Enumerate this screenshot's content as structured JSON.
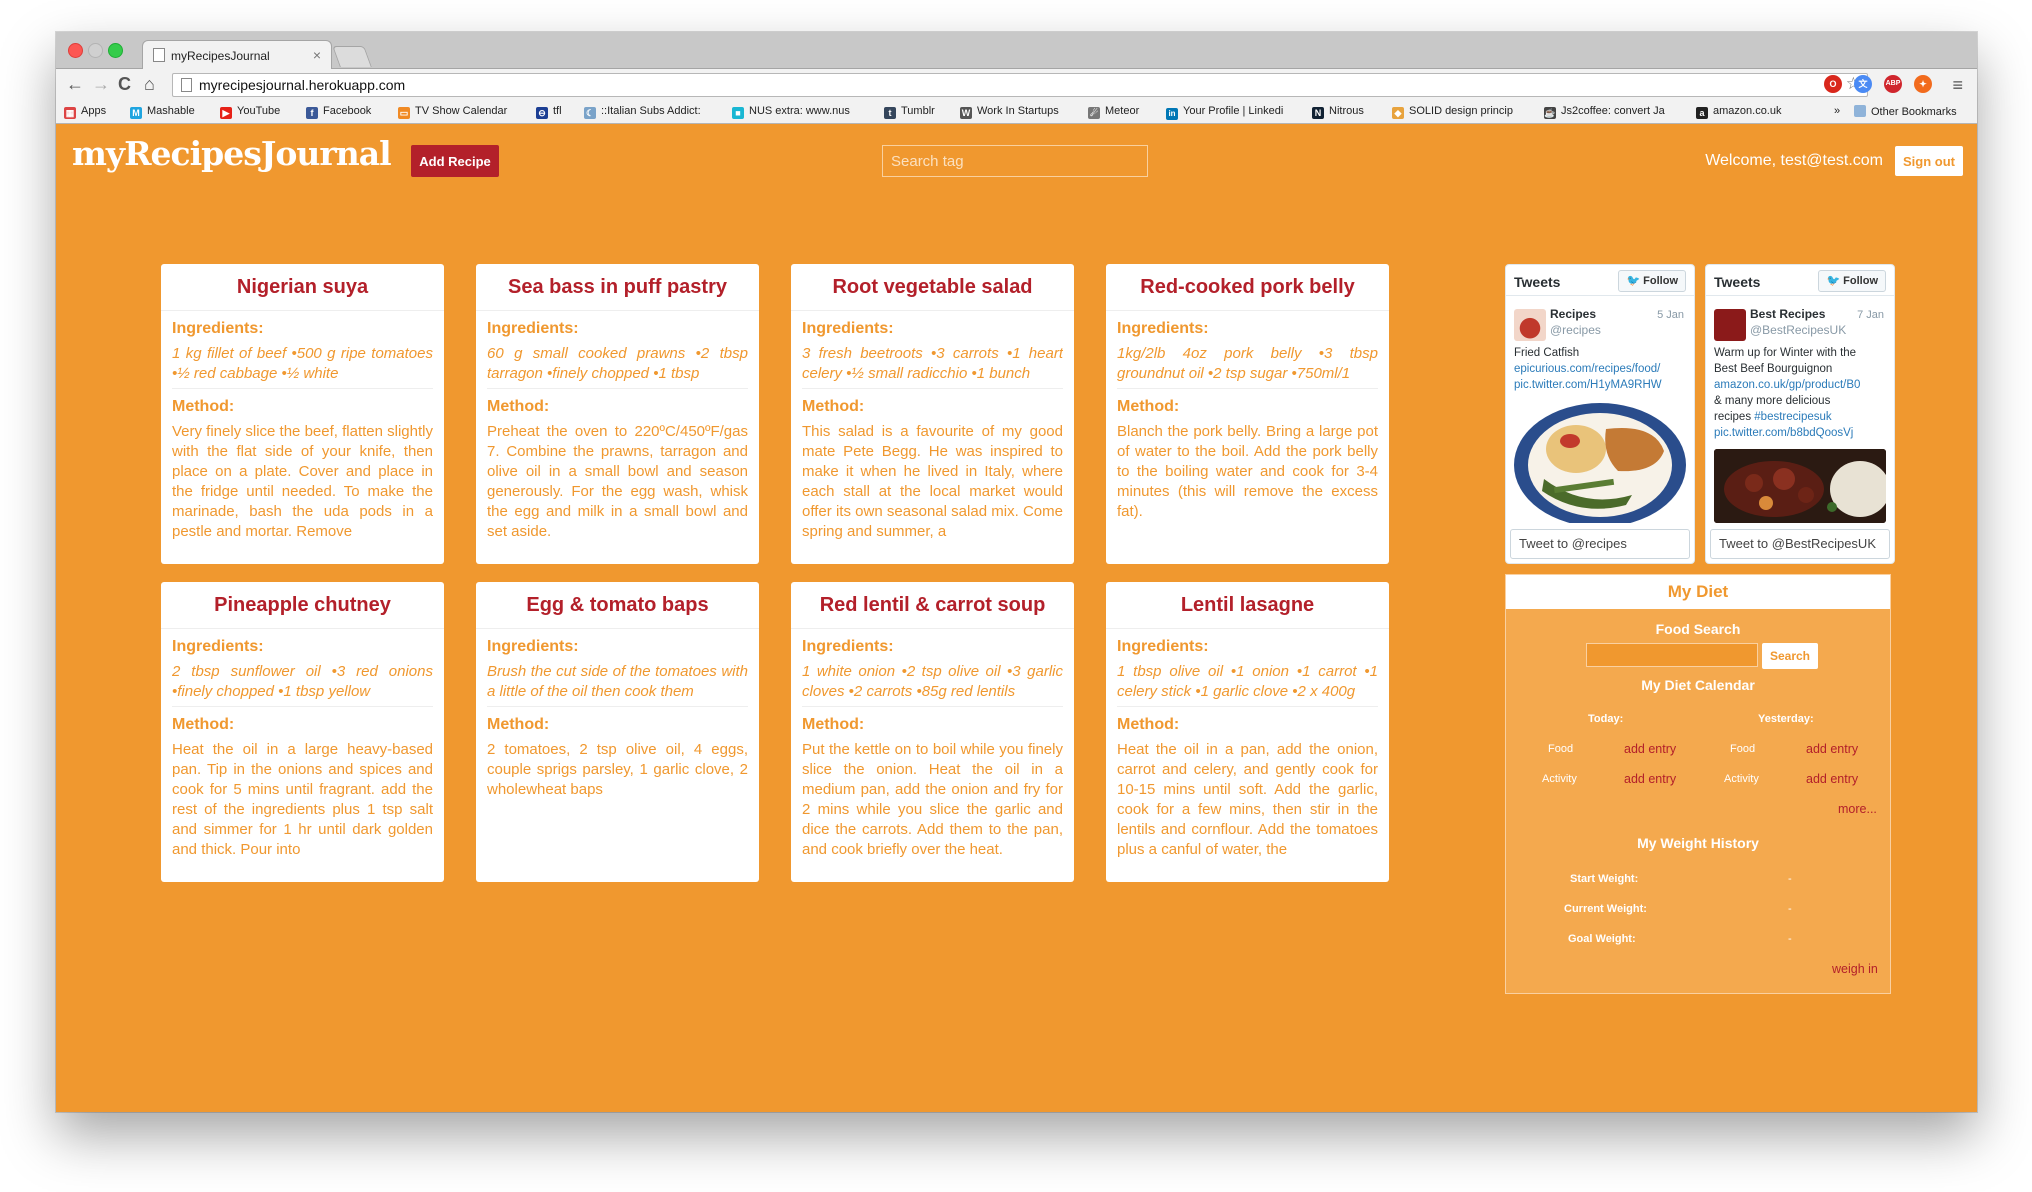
{
  "browser": {
    "tab_title": "myRecipesJournal",
    "tab_close": "×",
    "url": "myrecipesjournal.herokuapp.com",
    "back": "←",
    "forward": "→",
    "reload": "C",
    "home": "⌂",
    "star": "☆",
    "menu": "≡",
    "extensions": [
      {
        "name": "opera-ext-icon",
        "label": "O",
        "color": "#d9271c"
      },
      {
        "name": "translate-ext-icon",
        "label": "文",
        "color": "#4a8af4"
      },
      {
        "name": "adblock-ext-icon",
        "label": "ABP",
        "color": "#d0262d"
      },
      {
        "name": "flame-ext-icon",
        "label": "✦",
        "color": "#f26b1d"
      }
    ],
    "bookmarks": [
      {
        "name": "apps",
        "label": "Apps",
        "icon": "▦",
        "color": "#d44"
      },
      {
        "name": "mashable",
        "label": "Mashable",
        "icon": "M",
        "color": "#1fa5e0"
      },
      {
        "name": "youtube",
        "label": "YouTube",
        "icon": "▶",
        "color": "#e62117"
      },
      {
        "name": "facebook",
        "label": "Facebook",
        "icon": "f",
        "color": "#3b5998"
      },
      {
        "name": "tv-show-calendar",
        "label": "TV Show Calendar",
        "icon": "▭",
        "color": "#f08a24"
      },
      {
        "name": "tfl",
        "label": "tfl",
        "icon": "⊖",
        "color": "#1c3f94"
      },
      {
        "name": "italian-subs",
        "label": "::Italian Subs Addict:",
        "icon": "☾",
        "color": "#7aa3c9"
      },
      {
        "name": "nus-extra",
        "label": "NUS extra: www.nus",
        "icon": "■",
        "color": "#19b7d3"
      },
      {
        "name": "tumblr",
        "label": "Tumblr",
        "icon": "t",
        "color": "#35465c"
      },
      {
        "name": "work-in-startups",
        "label": "Work In Startups",
        "icon": "W",
        "color": "#555"
      },
      {
        "name": "meteor",
        "label": "Meteor",
        "icon": "☄",
        "color": "#777"
      },
      {
        "name": "linkedin",
        "label": "Your Profile | Linkedi",
        "icon": "in",
        "color": "#0077b5"
      },
      {
        "name": "nitrous",
        "label": "Nitrous",
        "icon": "N",
        "color": "#123"
      },
      {
        "name": "solid",
        "label": "SOLID design princip",
        "icon": "◆",
        "color": "#e8a33d"
      },
      {
        "name": "js2coffee",
        "label": "Js2coffee: convert Ja",
        "icon": "☕",
        "color": "#444"
      },
      {
        "name": "amazon",
        "label": "amazon.co.uk",
        "icon": "a",
        "color": "#222"
      }
    ],
    "bookmarks_more": "»",
    "other_bookmarks": "Other Bookmarks"
  },
  "header": {
    "logo": "myRecipesJournal",
    "add_recipe": "Add Recipe",
    "search_placeholder": "Search tag",
    "welcome": "Welcome, test@test.com",
    "sign_out": "Sign out"
  },
  "labels": {
    "ingredients": "Ingredients:",
    "method": "Method:"
  },
  "recipes": [
    {
      "title": "Nigerian suya",
      "ingredients": "1 kg fillet of beef •500 g ripe tomatoes •½ red cabbage •½ white",
      "method": "Very finely slice the beef, flatten slightly with the flat side of your knife, then place on a plate. Cover and place in the fridge until needed. To make the marinade, bash the uda pods in a pestle and mortar. Remove"
    },
    {
      "title": "Sea bass in puff pastry",
      "ingredients": "60 g small cooked prawns •2 tbsp tarragon •finely chopped •1 tbsp",
      "method": "Preheat the oven to 220ºC/450ºF/gas 7. Combine the prawns, tarragon and olive oil in a small bowl and season generously. For the egg wash, whisk the egg and milk in a small bowl and set aside."
    },
    {
      "title": "Root vegetable salad",
      "ingredients": "3 fresh beetroots •3 carrots •1 heart celery •½ small radicchio •1 bunch",
      "method": "This salad is a favourite of my good mate Pete Begg. He was inspired to make it when he lived in Italy, where each stall at the local market would offer its own seasonal salad mix. Come spring and summer, a"
    },
    {
      "title": "Red-cooked pork belly",
      "ingredients": "1kg/2lb 4oz pork belly •3 tbsp groundnut oil •2 tsp sugar •750ml/1",
      "method": "Blanch the pork belly. Bring a large pot of water to the boil. Add the pork belly to the boiling water and cook for 3-4 minutes (this will remove the excess fat)."
    },
    {
      "title": "Pineapple chutney",
      "ingredients": "2 tbsp sunflower oil •3 red onions •finely chopped •1 tbsp yellow",
      "method": "Heat the oil in a large heavy-based pan. Tip in the onions and spices and cook for 5 mins until fragrant. add the rest of the ingredients plus 1 tsp salt and simmer for 1 hr until dark golden and thick. Pour into"
    },
    {
      "title": "Egg & tomato baps",
      "ingredients": "Brush the cut side of the tomatoes with a little of the oil then cook them",
      "method": "2 tomatoes, 2 tsp olive oil, 4 eggs, couple sprigs parsley, 1 garlic clove, 2 wholewheat baps"
    },
    {
      "title": "Red lentil & carrot soup",
      "ingredients": "1 white onion •2 tsp olive oil •3 garlic cloves •2 carrots •85g red lentils",
      "method": "Put the kettle on to boil while you finely slice the onion. Heat the oil in a medium pan, add the onion and fry for 2 mins while you slice the garlic and dice the carrots. Add them to the pan, and cook briefly over the heat."
    },
    {
      "title": "Lentil lasagne",
      "ingredients": "1 tbsp olive oil •1 onion •1 carrot •1 celery stick •1 garlic clove •2 x 400g",
      "method": "Heat the oil in a pan, add the onion, carrot and celery, and gently cook for 10-15 mins until soft. Add the garlic, cook for a few mins, then stir in the lentils and cornflour. Add the tomatoes plus a canful of water, the"
    }
  ],
  "tweets": [
    {
      "header": "Tweets",
      "follow": "Follow",
      "name": "Recipes",
      "handle": "@recipes",
      "date": "5 Jan",
      "lines": [
        "Fried Catfish"
      ],
      "links": [
        "epicurious.com/recipes/food/",
        "pic.twitter.com/H1yMA9RHW"
      ],
      "compose": "Tweet to @recipes",
      "avatar_color": "#c0392b"
    },
    {
      "header": "Tweets",
      "follow": "Follow",
      "name": "Best Recipes",
      "handle": "@BestRecipesUK",
      "date": "7 Jan",
      "lines": [
        "Warm up for Winter with the",
        "Best Beef Bourguignon"
      ],
      "link1": "amazon.co.uk/gp/product/B0",
      "line3": "& many more delicious",
      "line4_text": "recipes ",
      "line4_link": "#bestrecipesuk",
      "link2": "pic.twitter.com/b8bdQoosVj",
      "compose": "Tweet to @BestRecipesUK",
      "avatar_color": "#8b1a1a"
    }
  ],
  "diet": {
    "title": "My Diet",
    "food_search": "Food Search",
    "search_button": "Search",
    "calendar_title": "My Diet Calendar",
    "today": "Today:",
    "yesterday": "Yesterday:",
    "food": "Food",
    "activity": "Activity",
    "add_entry": "add entry",
    "more": "more...",
    "weight_title": "My Weight History",
    "start_weight": "Start Weight:",
    "current_weight": "Current Weight:",
    "goal_weight": "Goal Weight:",
    "dash": "-",
    "weigh_in": "weigh in"
  }
}
